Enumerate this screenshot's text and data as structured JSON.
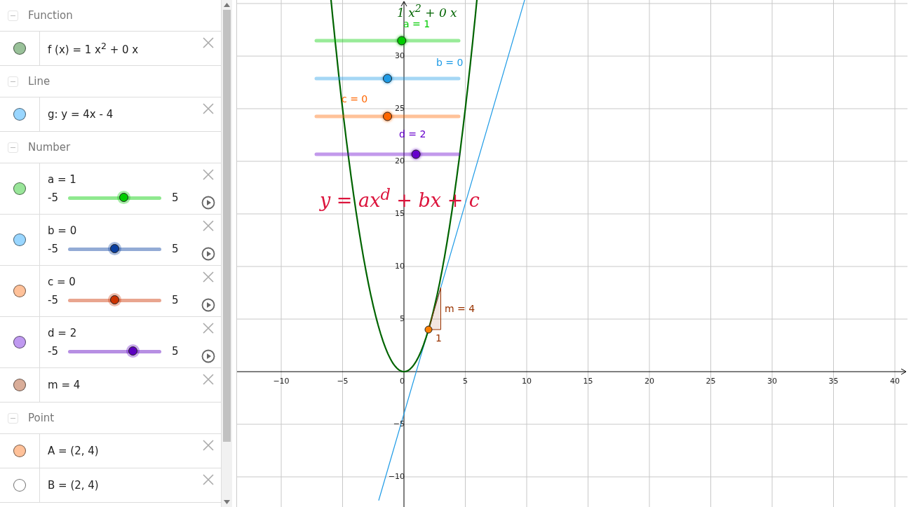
{
  "algebra": {
    "groups": [
      {
        "title": "Function",
        "items": [
          {
            "kind": "expression",
            "color": "#99c199",
            "text": "f (x) = 1 x$^{2}$ + 0 x"
          }
        ]
      },
      {
        "title": "Line",
        "items": [
          {
            "kind": "expression",
            "color": "#99d6ff",
            "text": "g: y = 4x - 4"
          }
        ]
      },
      {
        "title": "Number",
        "items": [
          {
            "kind": "slider",
            "color": "#99e599",
            "text": "a = 1",
            "min": "-5",
            "max": "5",
            "slider": {
              "level": 0.6,
              "color": "#00cc00"
            }
          },
          {
            "kind": "slider",
            "color": "#99d6ff",
            "text": "b = 0",
            "min": "-5",
            "max": "5",
            "slider": {
              "level": 0.5,
              "color": "#0a3fa0"
            }
          },
          {
            "kind": "slider",
            "color": "#ffc199",
            "text": "c = 0",
            "min": "-5",
            "max": "5",
            "slider": {
              "level": 0.5,
              "color": "#cc3300"
            }
          },
          {
            "kind": "slider",
            "color": "#bf99f0",
            "text": "d = 2",
            "min": "-5",
            "max": "5",
            "slider": {
              "level": 0.7,
              "color": "#5c00c0"
            }
          },
          {
            "kind": "expression",
            "color": "#d9ad99",
            "text": "m = 4"
          }
        ]
      },
      {
        "title": "Point",
        "items": [
          {
            "kind": "expression",
            "color": "#ffc199",
            "text": "A = (2, 4)"
          },
          {
            "kind": "expression",
            "color": "#ffffff",
            "text": "B = (2, 4)"
          }
        ]
      }
    ]
  },
  "graphics": {
    "curve_label": "1 x$^{2}$ + 0 x",
    "sliders": [
      {
        "label": "a = 1",
        "color": "#00cc00",
        "level": 0.6
      },
      {
        "label": "b = 0",
        "color": "#1e9be6",
        "level": 0.5
      },
      {
        "label": "c = 0",
        "color": "#ff6600",
        "level": 0.5
      },
      {
        "label": "d = 2",
        "color": "#6600cc",
        "level": 0.7
      }
    ],
    "formula": "y = ax$^{d}$ + bx + c",
    "slope_label": "m = 4",
    "run_label": "1",
    "x_ticks": [
      "−10",
      "−5",
      "0",
      "5",
      "10",
      "15",
      "20",
      "25",
      "30",
      "35",
      "40"
    ],
    "y_ticks": [
      "30",
      "25",
      "20",
      "15",
      "10",
      "5",
      "−5",
      "−10"
    ]
  }
}
